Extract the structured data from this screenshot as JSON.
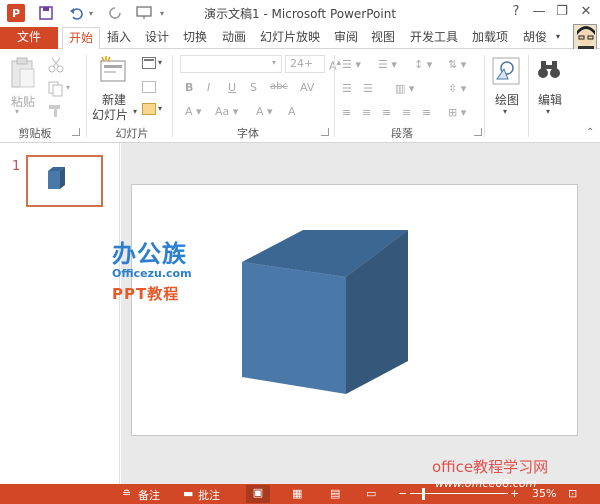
{
  "window": {
    "title": "演示文稿1 - Microsoft PowerPoint",
    "app_logo": "P",
    "controls": [
      "?",
      "—",
      "❐",
      "✕"
    ]
  },
  "tabs": [
    {
      "label": "文件"
    },
    {
      "label": "开始"
    },
    {
      "label": "插入"
    },
    {
      "label": "设计"
    },
    {
      "label": "切换"
    },
    {
      "label": "动画"
    },
    {
      "label": "幻灯片放映"
    },
    {
      "label": "审阅"
    },
    {
      "label": "视图"
    },
    {
      "label": "开发工具"
    },
    {
      "label": "加载项"
    },
    {
      "label": "胡俊"
    }
  ],
  "ribbon": {
    "clipboard": {
      "paste_label": "粘贴",
      "group_label": "剪贴板"
    },
    "slides": {
      "new_slide_label_1": "新建",
      "new_slide_label_2": "幻灯片",
      "group_label": "幻灯片"
    },
    "font": {
      "size_value": "24+",
      "group_label": "字体"
    },
    "paragraph": {
      "group_label": "段落"
    },
    "drawing": {
      "label": "绘图"
    },
    "editing": {
      "label": "编辑"
    }
  },
  "thumbnail_pane": {
    "slide_number": "1"
  },
  "watermark": {
    "logo_text": "办公族",
    "logo_url": "Officezu.com",
    "logo_sub": "PPT教程",
    "bottom_text": "office教程学习网",
    "bottom_url": "www.office68.com"
  },
  "statusbar": {
    "notes_label": "备注",
    "comments_label": "批注",
    "zoom": "35%"
  },
  "colors": {
    "accent": "#d24726",
    "cube_front": "#4a78a8",
    "cube_top": "#3d6793",
    "cube_side": "#35577a"
  }
}
